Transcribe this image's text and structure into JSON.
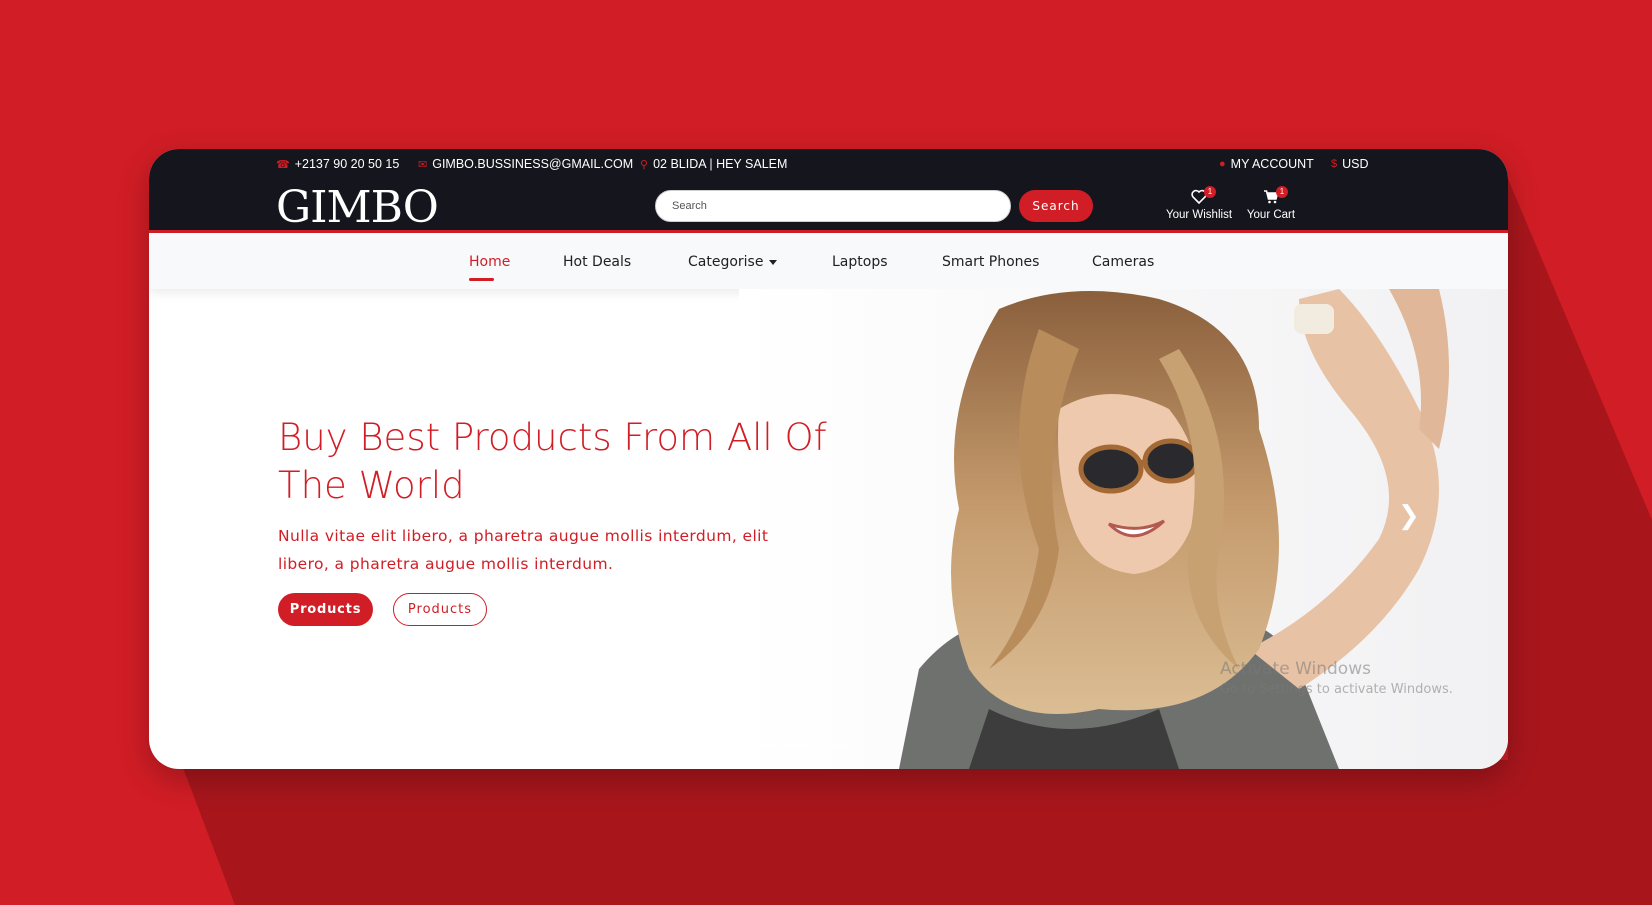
{
  "topbar": {
    "phone": "+2137 90 20 50 15",
    "email": "GIMBO.BUSSINESS@GMAIL.COM",
    "address": "02 BLIDA | HEY SALEM",
    "account": "MY ACCOUNT",
    "currency": "USD"
  },
  "header": {
    "logo": "GIMBO",
    "search_placeholder": "Search",
    "search_button": "Search",
    "wishlist_label": "Your Wishlist",
    "wishlist_count": "1",
    "cart_label": "Your Cart",
    "cart_count": "1"
  },
  "nav": {
    "items": [
      {
        "label": "Home",
        "active": true
      },
      {
        "label": "Hot Deals"
      },
      {
        "label": "Categorise"
      },
      {
        "label": "Laptops"
      },
      {
        "label": "Smart Phones"
      },
      {
        "label": "Cameras"
      }
    ]
  },
  "hero": {
    "title": "Buy Best Products From All Of The World",
    "text": "Nulla vitae elit libero, a pharetra augue mollis interdum, elit libero, a pharetra augue mollis interdum.",
    "button_primary": "Products",
    "button_secondary": "Products"
  },
  "watermark": {
    "line1": "Activate Windows",
    "line2": "Go to Settings to activate Windows."
  },
  "colors": {
    "accent": "#d11d25",
    "dark": "#15161d",
    "nav_bg": "#f8f9fa"
  },
  "icons": [
    "phone-icon",
    "envelope-icon",
    "map-pin-icon",
    "user-icon",
    "dollar-icon",
    "heart-icon",
    "cart-icon",
    "chevron-right-icon"
  ]
}
